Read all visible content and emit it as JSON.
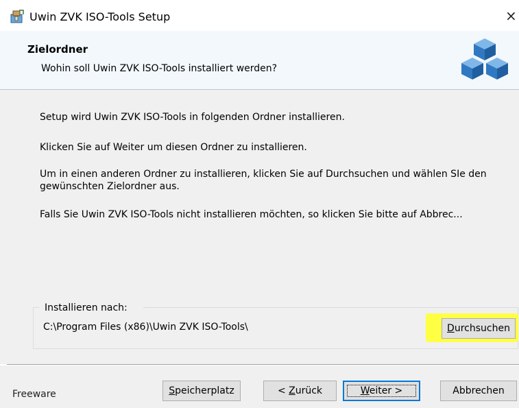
{
  "window": {
    "title": "Uwin ZVK ISO-Tools Setup",
    "close_glyph": "×"
  },
  "header": {
    "title": "Zielordner",
    "subtitle": "Wohin soll Uwin ZVK ISO-Tools installiert werden?"
  },
  "content": {
    "line1": "Setup wird Uwin ZVK ISO-Tools in folgenden Ordner installieren.",
    "line2": "Klicken Sie auf Weiter um diesen Ordner zu installieren.",
    "line3": "Um in einen anderen Ordner zu installieren, klicken Sie auf Durchsuchen und wählen SIe den gewünschten Zielordner aus.",
    "line4": "Falls Sie Uwin ZVK ISO-Tools nicht installieren möchten, so klicken Sie bitte auf Abbrec..."
  },
  "destination": {
    "legend": "Installieren nach:",
    "path": "C:\\Program Files (x86)\\Uwin ZVK ISO-Tools\\",
    "browse_prefix": "D",
    "browse_rest": "urchsuchen"
  },
  "footer": {
    "brand": "Freeware",
    "space_prefix": "S",
    "space_rest": "peicherplatz",
    "back_pre": "< ",
    "back_u": "Z",
    "back_rest": "urück",
    "next_u": "W",
    "next_rest": "eiter >",
    "cancel": "Abbrechen"
  },
  "colors": {
    "highlight": "#ffff44",
    "default_button_border": "#0078d7"
  },
  "icons": {
    "app": "installer-box-icon",
    "header_logo": "blue-cubes-icon",
    "close": "close-icon"
  }
}
